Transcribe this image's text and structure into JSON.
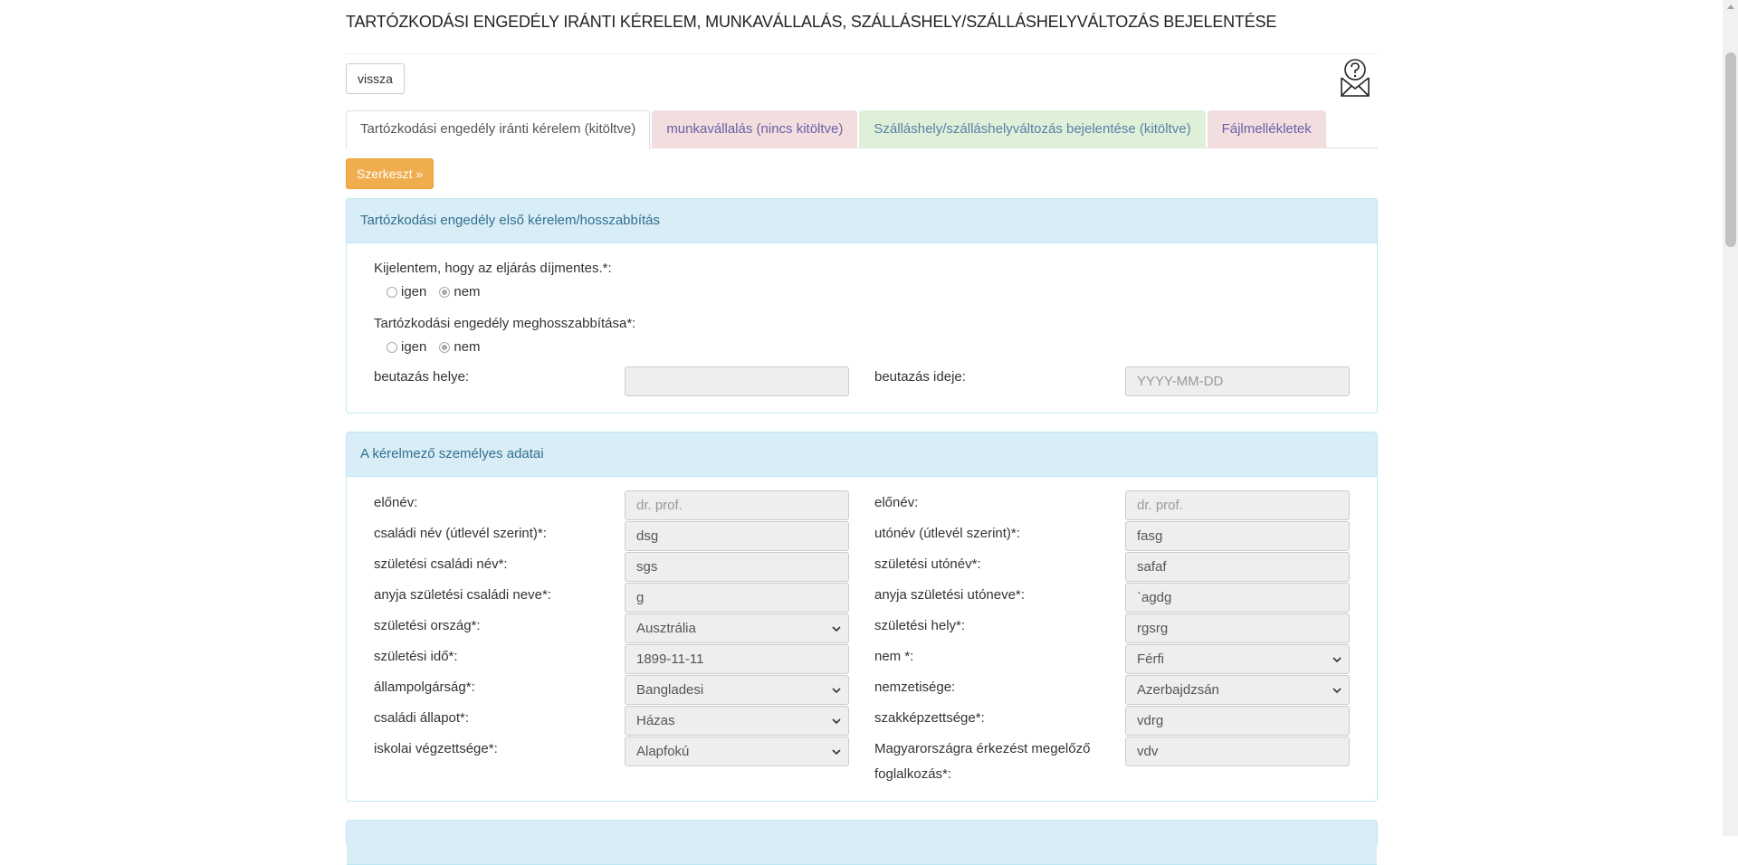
{
  "page": {
    "title": "TARTÓZKODÁSI ENGEDÉLY IRÁNTI KÉRELEM, MUNKAVÁLLALÁS, SZÁLLÁSHELY/SZÁLLÁSHELYVÁLTOZÁS BEJELENTÉSE"
  },
  "toolbar": {
    "back_label": "vissza",
    "help_icon": "envelope-question-icon"
  },
  "tabs": [
    {
      "label": "Tartózkodási engedély iránti kérelem (kitöltve)",
      "state": "active"
    },
    {
      "label": "munkavállalás (nincs kitöltve)",
      "state": "empty",
      "color": "#f2dede"
    },
    {
      "label": "Szálláshely/szálláshelyváltozás bejelentése (kitöltve)",
      "state": "filled",
      "color": "#dff0d8"
    },
    {
      "label": "Fájlmellékletek",
      "state": "empty",
      "color": "#f2dede"
    }
  ],
  "edit_button": {
    "label": "Szerkeszt »",
    "color": "#f0ad4e"
  },
  "panel1": {
    "heading": "Tartózkodási engedély első kérelem/hosszabbítás",
    "q1": {
      "label": "Kijelentem, hogy az eljárás díjmentes.*:",
      "options": [
        "igen",
        "nem"
      ],
      "selected": "nem"
    },
    "q2": {
      "label": "Tartózkodási engedély meghosszabbítása*:",
      "options": [
        "igen",
        "nem"
      ],
      "selected": "nem"
    },
    "entry_place": {
      "label": "beutazás helye:",
      "value": ""
    },
    "entry_time": {
      "label": "beutazás ideje:",
      "placeholder": "YYYY-MM-DD"
    }
  },
  "panel2": {
    "heading": "A kérelmező személyes adatai",
    "left": [
      {
        "label": "előnév:",
        "value": "dr. prof.",
        "placeholder": true
      },
      {
        "label": "családi név (útlevél szerint)*:",
        "value": "dsg"
      },
      {
        "label": "születési családi név*:",
        "value": "sgs"
      },
      {
        "label": "anyja születési családi neve*:",
        "value": "g"
      },
      {
        "label": "születési ország*:",
        "value": "Ausztrália",
        "select": true
      },
      {
        "label": "születési idő*:",
        "value": "1899-11-11"
      },
      {
        "label": "állampolgárság*:",
        "value": "Bangladesi",
        "select": true
      },
      {
        "label": "családi állapot*:",
        "value": "Házas",
        "select": true
      },
      {
        "label": "iskolai végzettsége*:",
        "value": "Alapfokú",
        "select": true
      }
    ],
    "right": [
      {
        "label": "előnév:",
        "value": "dr. prof.",
        "placeholder": true
      },
      {
        "label": "utónév (útlevél szerint)*:",
        "value": "fasg"
      },
      {
        "label": "születési utónév*:",
        "value": "safaf"
      },
      {
        "label": "anyja születési utóneve*:",
        "value": "`agdg"
      },
      {
        "label": "születési hely*:",
        "value": "rgsrg"
      },
      {
        "label": "nem *:",
        "value": "Férfi",
        "select": true
      },
      {
        "label": "nemzetisége:",
        "value": "Azerbajdzsán",
        "select": true
      },
      {
        "label": "szakképzettsége*:",
        "value": "vdrg"
      },
      {
        "label": "Magyarországra érkezést megelőző",
        "label2": "foglalkozás*:",
        "value": "vdv"
      }
    ]
  }
}
